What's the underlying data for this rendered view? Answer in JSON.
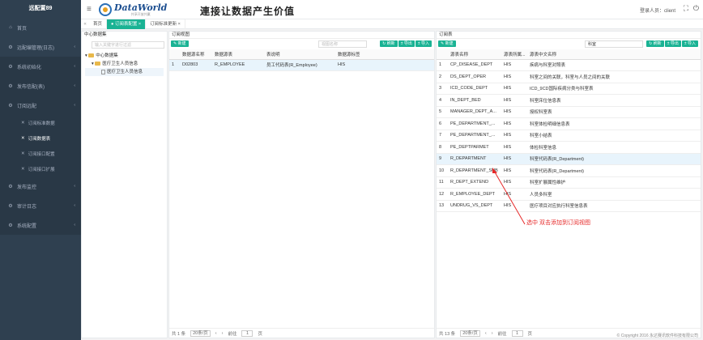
{
  "app": {
    "brand": "远配置89"
  },
  "sidebar": {
    "items": [
      {
        "icon": "⌂",
        "label": "首页"
      },
      {
        "icon": "⚙",
        "label": "远配编管理(日志)"
      },
      {
        "icon": "⚙",
        "label": "系统初始化"
      },
      {
        "icon": "⚙",
        "label": "发布信配(表)"
      },
      {
        "icon": "⚙",
        "label": "订阅远配"
      }
    ],
    "subitems": [
      {
        "label": "订阅标准数据"
      },
      {
        "label": "订阅数据表"
      },
      {
        "label": "订阅接口配置"
      },
      {
        "label": "订阅接口扩展"
      }
    ],
    "bottom": [
      {
        "icon": "⚙",
        "label": "发布监控"
      },
      {
        "icon": "⚙",
        "label": "审计日志"
      },
      {
        "icon": "⚙",
        "label": "系统配置"
      }
    ]
  },
  "header": {
    "logo_text": "DataWorld",
    "logo_sub": "共享开放共赢",
    "slogan": "让数据产生价值",
    "slogan_lead": "連接",
    "user": "登录人员：client"
  },
  "tabs": [
    {
      "label": "首页"
    },
    {
      "label": "● 订阅表配置 ×"
    },
    {
      "label": "订阅标准更新 ×"
    }
  ],
  "left": {
    "title": "中心数据集",
    "search_placeholder": "输入关键字进行过滤",
    "nodes": [
      "中心数据集",
      "医疗卫生人员信息",
      "医疗卫生人员信息"
    ]
  },
  "middle": {
    "title": "订阅视图",
    "add": "新建",
    "search_placeholder": "视图名称",
    "buttons": [
      "刷新",
      "导出",
      "导入"
    ],
    "columns": [
      "",
      "数据源名称",
      "数据源表",
      "表说明",
      "数据源标签"
    ],
    "rows": [
      {
        "n": "1",
        "a": "D02803",
        "b": "R_EMPLOYEE",
        "c": "员工代码表(R_Employee)",
        "d": "HIS"
      }
    ],
    "footer": {
      "total": "共 1 条",
      "per": "20条/页",
      "goto": "前往",
      "page": "1",
      "unit": "页"
    }
  },
  "right": {
    "title": "订阅表",
    "add": "新建",
    "search_value": "科室",
    "buttons": [
      "刷新",
      "导出",
      "导入"
    ],
    "columns": [
      "",
      "源表名称",
      "源表所属...",
      "源表中文名称"
    ],
    "rows": [
      {
        "n": "1",
        "a": "CP_DISEASE_DEPT",
        "b": "HIS",
        "c": "疾病与科室对照表"
      },
      {
        "n": "2",
        "a": "DS_DEPT_OPER",
        "b": "HIS",
        "c": "科室之间的关联，科室与人员之间的关联"
      },
      {
        "n": "3",
        "a": "ICD_CODE_DEPT",
        "b": "HIS",
        "c": "ICD_9CD国际疾病分类与科室表"
      },
      {
        "n": "4",
        "a": "IN_DEPT_BED",
        "b": "HIS",
        "c": "科室床位信息表"
      },
      {
        "n": "5",
        "a": "MANAGER_DEPT_A...",
        "b": "HIS",
        "c": "授权科室表"
      },
      {
        "n": "6",
        "a": "PE_DEPARTMENT_...",
        "b": "HIS",
        "c": "科室体检明细信息表"
      },
      {
        "n": "7",
        "a": "PE_DEPARTMENT_...",
        "b": "HIS",
        "c": "科室小结表"
      },
      {
        "n": "8",
        "a": "PE_DEPTPARMET",
        "b": "HIS",
        "c": "体检科室信息"
      },
      {
        "n": "9",
        "a": "R_DEPARTMENT",
        "b": "HIS",
        "c": "科室代码表(R_Department)"
      },
      {
        "n": "10",
        "a": "R_DEPARTMENT_SUB",
        "b": "HIS",
        "c": "科室代码表(R_Department)"
      },
      {
        "n": "11",
        "a": "R_DEPT_EXTEND",
        "b": "HIS",
        "c": "科室扩展属性维护"
      },
      {
        "n": "12",
        "a": "R_EMPLOYEE_DEPT",
        "b": "HIS",
        "c": "人员多科室"
      },
      {
        "n": "13",
        "a": "UNDRUG_VS_DEPT",
        "b": "HIS",
        "c": "医疗项目对应执行科室信息表"
      }
    ],
    "footer": {
      "total": "共 13 条",
      "per": "20条/页",
      "goto": "前往",
      "page": "1",
      "unit": "页"
    }
  },
  "annotation": "选中 双击添加到订阅视图",
  "copyright": "© Copyright 2016 永达赛讯软件科技有限公司",
  "colors": {
    "sidebar": "#2f4050",
    "accent": "#1ab394",
    "note": "#e62929"
  }
}
